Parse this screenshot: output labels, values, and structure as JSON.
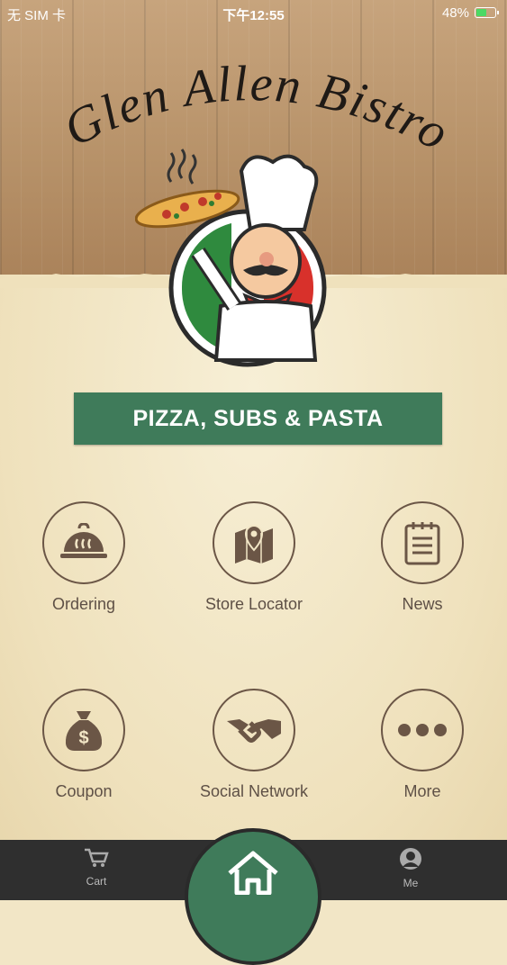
{
  "status_bar": {
    "carrier": "无 SIM 卡",
    "time": "下午12:55",
    "battery": "48%",
    "battery_level": 0.48
  },
  "header": {
    "logo_text": "Glen Allen Bistro"
  },
  "banner": {
    "text": "PIZZA, SUBS & PASTA"
  },
  "menu": {
    "items": [
      {
        "label": "Ordering",
        "icon": "cloche-icon"
      },
      {
        "label": "Store Locator",
        "icon": "map-pin-icon"
      },
      {
        "label": "News",
        "icon": "notepad-icon"
      },
      {
        "label": "Coupon",
        "icon": "money-bag-icon"
      },
      {
        "label": "Social Network",
        "icon": "handshake-icon"
      },
      {
        "label": "More",
        "icon": "more-dots-icon"
      }
    ]
  },
  "tab_bar": {
    "cart_label": "Cart",
    "me_label": "Me",
    "home_icon": "home-icon"
  },
  "colors": {
    "brand_green": "#3f7b5a",
    "icon_brown": "#6b5646",
    "tab_bar": "#2f2f2f"
  }
}
